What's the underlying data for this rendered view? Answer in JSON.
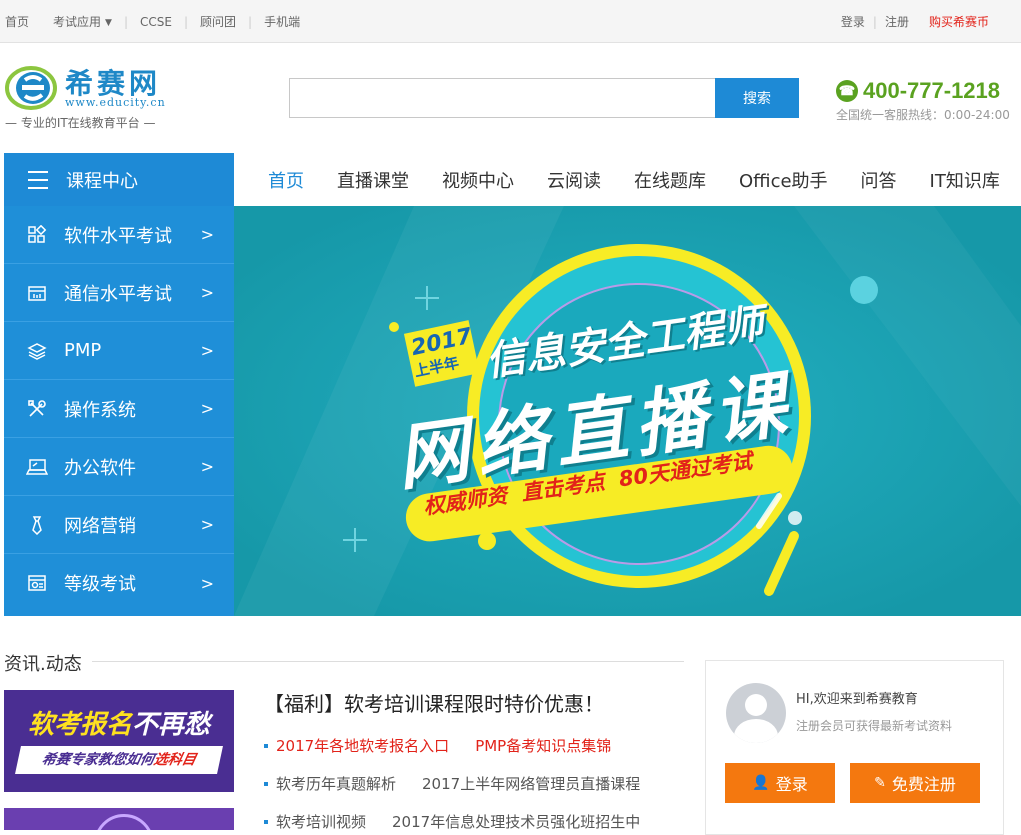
{
  "topbar": {
    "items": [
      "首页",
      "考试应用",
      "CCSE",
      "顾问团",
      "手机端"
    ],
    "login": "登录",
    "register": "注册",
    "buy": "购买希赛币"
  },
  "logo": {
    "name": "希赛网",
    "url": "www.educity.cn",
    "slogan": "— 专业的IT在线教育平台 —"
  },
  "search": {
    "placeholder": "",
    "button": "搜索"
  },
  "hotline": {
    "number": "400-777-1218",
    "sub": "全国统一客服热线：0:00-24:00"
  },
  "nav": {
    "course_center": "课程中心",
    "items": [
      "首页",
      "直播课堂",
      "视频中心",
      "云阅读",
      "在线题库",
      "Office助手",
      "问答",
      "IT知识库"
    ]
  },
  "sidebar": {
    "arrow": ">",
    "items": [
      "软件水平考试",
      "通信水平考试",
      "PMP",
      "操作系统",
      "办公软件",
      "网络营销",
      "等级考试"
    ]
  },
  "banner": {
    "year": "2017",
    "half": "上半年",
    "title": "信息安全工程师",
    "subtitle": "网络直播课",
    "tagline": "权威师资  直击考点  80天通过考试"
  },
  "news": {
    "section_title": "资讯.动态",
    "headline": "【福利】软考培训课程限时特价优惠！",
    "row1": [
      "2017年各地软考报名入口",
      "PMP备考知识点集锦"
    ],
    "row2": [
      "软考历年真题解析",
      "2017上半年网络管理员直播课程"
    ],
    "row3": [
      "软考培训视频",
      "2017年信息处理技术员强化班招生中"
    ]
  },
  "promo": {
    "line1_a": "软考报名",
    "line1_b": "不再愁",
    "line2_a": "希赛专家教您如何",
    "line2_b": "选科目"
  },
  "login_box": {
    "greeting": "HI,欢迎来到希赛教育",
    "tip": "注册会员可获得最新考试资料",
    "login": "登录",
    "register": "免费注册"
  },
  "colors": {
    "brand_blue": "#1e8ad6",
    "accent_orange": "#f4780f",
    "hotline_green": "#5aa220",
    "banner_teal": "#1a9db0"
  }
}
